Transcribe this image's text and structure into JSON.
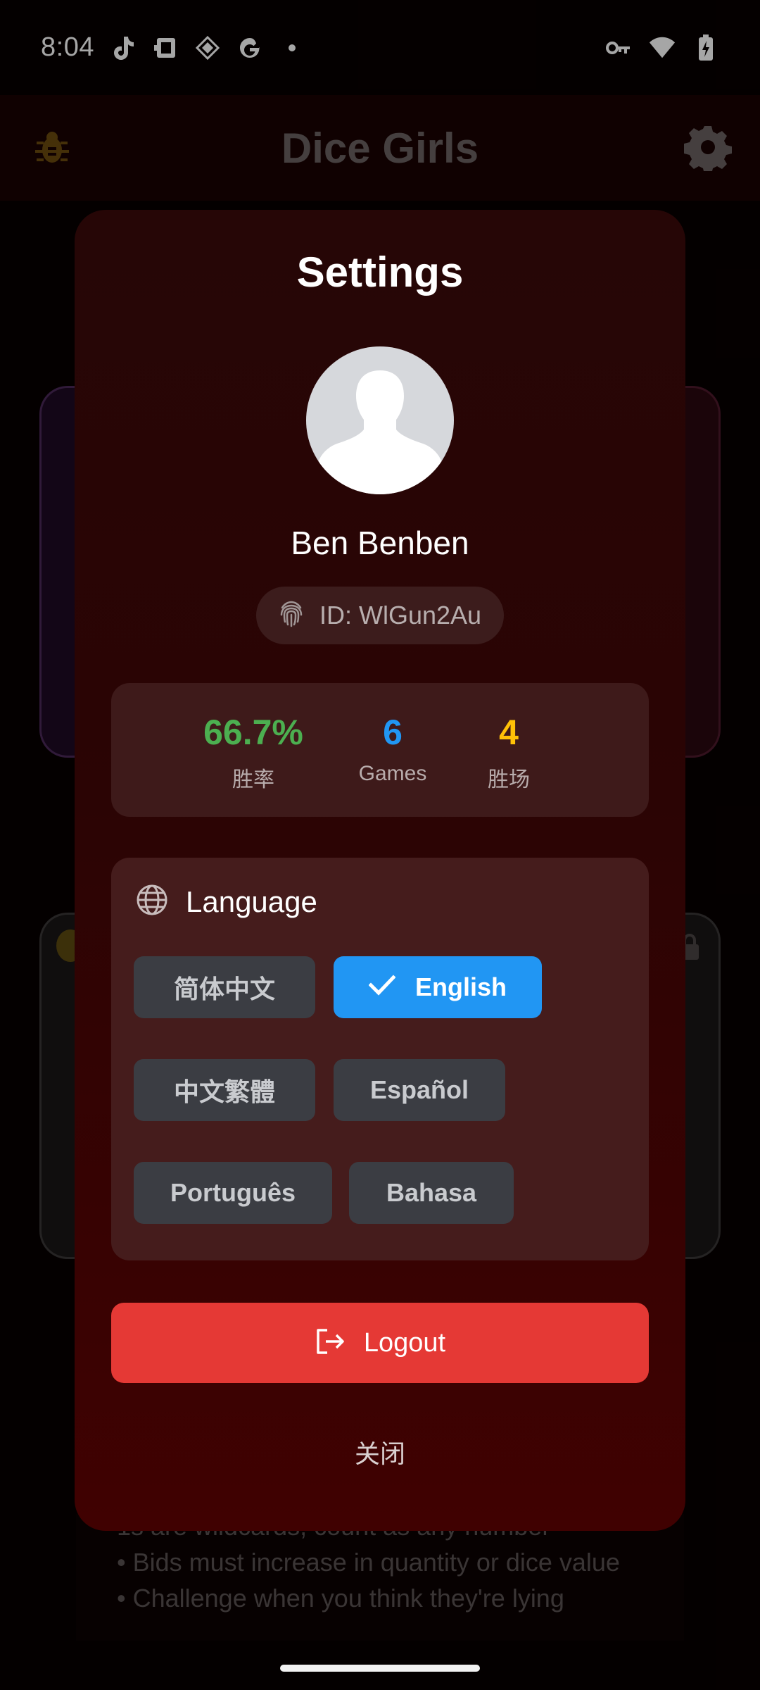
{
  "status_bar": {
    "time": "8:04",
    "icons": [
      "tiktok-icon",
      "app-notification-icon",
      "shield-app-icon",
      "google-icon",
      "dot-icon",
      "vpn-key-icon",
      "wifi-icon",
      "battery-charging-icon"
    ]
  },
  "app_bar": {
    "title": "Dice Girls",
    "left_icon": "bug-icon",
    "right_icon": "gear-icon"
  },
  "background_rules": [
    "1s are wildcards, count as any number",
    "• Bids must increase in quantity or dice value",
    "• Challenge when you think they're lying"
  ],
  "settings_dialog": {
    "title": "Settings",
    "avatar_icon": "default-avatar-icon",
    "user_name": "Ben Benben",
    "user_id": "ID: WlGun2Au",
    "id_icon": "fingerprint-icon",
    "stats": {
      "win_rate": {
        "value": "66.7%",
        "label": "胜率",
        "color": "#4caf50"
      },
      "games": {
        "value": "6",
        "label": "Games",
        "color": "#2196f3"
      },
      "wins": {
        "value": "4",
        "label": "胜场",
        "color": "#ffc107"
      }
    },
    "language": {
      "title": "Language",
      "icon": "globe-icon",
      "selected": "English",
      "options": [
        "简体中文",
        "English",
        "中文繁體",
        "Español",
        "Português",
        "Bahasa"
      ]
    },
    "logout_label": "Logout",
    "logout_icon": "logout-icon",
    "close_label": "关闭"
  },
  "colors": {
    "accent_blue": "#2196f3",
    "danger_red": "#e53935"
  }
}
